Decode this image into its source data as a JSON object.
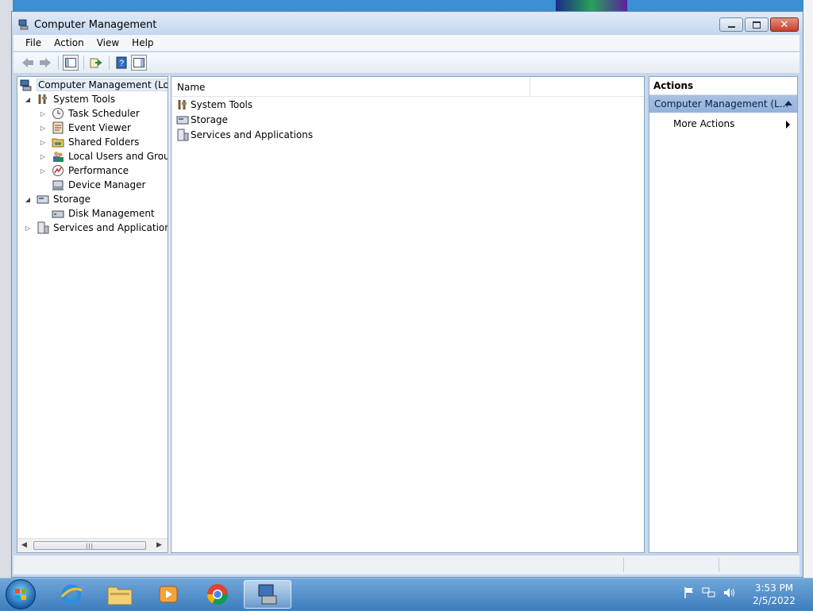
{
  "window": {
    "title": "Computer Management",
    "menu": [
      "File",
      "Action",
      "View",
      "Help"
    ]
  },
  "tree": {
    "root": "Computer Management (Local",
    "items": [
      {
        "label": "System Tools",
        "expander": "expanded"
      },
      {
        "label": "Task Scheduler",
        "expander": "collapsed"
      },
      {
        "label": "Event Viewer",
        "expander": "collapsed"
      },
      {
        "label": "Shared Folders",
        "expander": "collapsed"
      },
      {
        "label": "Local Users and Groups",
        "expander": "collapsed"
      },
      {
        "label": "Performance",
        "expander": "collapsed"
      },
      {
        "label": "Device Manager",
        "expander": "none"
      },
      {
        "label": "Storage",
        "expander": "expanded"
      },
      {
        "label": "Disk Management",
        "expander": "none"
      },
      {
        "label": "Services and Applications",
        "expander": "collapsed"
      }
    ]
  },
  "content": {
    "column_name": "Name",
    "items": [
      "System Tools",
      "Storage",
      "Services and Applications"
    ]
  },
  "actions": {
    "header": "Actions",
    "group_label": "Computer Management (L...",
    "more_actions": "More Actions"
  },
  "taskbar": {
    "apps": [
      "windows-explorer",
      "internet-explorer",
      "media-player",
      "chrome",
      "computer-management"
    ],
    "time": "3:53 PM",
    "date": "2/5/2022"
  },
  "colors": {
    "selection": "#e5eef8",
    "actions_group": "#a9c2e3",
    "taskbar": "#3f7dbf"
  }
}
